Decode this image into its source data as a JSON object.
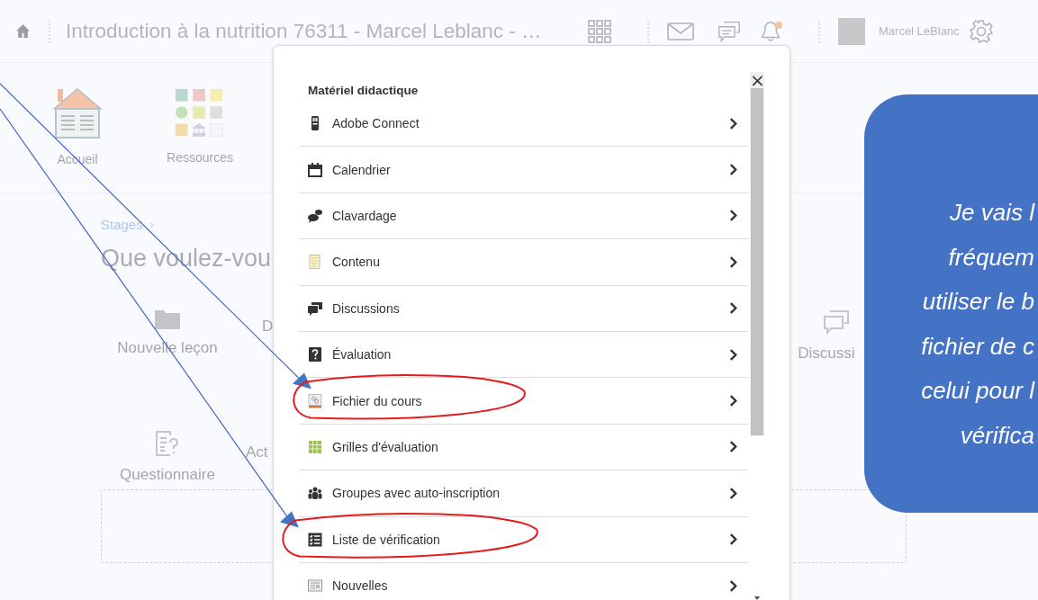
{
  "top_bar": {
    "title": "Introduction à la nutrition 76311 - Marcel Leblanc - …",
    "user_name": "Marcel LeBlanc",
    "notification_dot": true
  },
  "nav": [
    {
      "label": "Accueil",
      "kind": "home"
    },
    {
      "label": "Ressources",
      "kind": "resources"
    }
  ],
  "breadcrumb": {
    "label": "Stages",
    "separator": "›"
  },
  "heading": "Que voulez-vou",
  "tiles_row_1": [
    {
      "label": "Nouvelle leçon",
      "kind": "folder"
    },
    {
      "label": "D",
      "kind": "text"
    },
    {
      "label": "Discussi",
      "kind": "chat"
    }
  ],
  "tiles_row_2": [
    {
      "label": "Questionnaire",
      "kind": "quiz"
    },
    {
      "label": "Act",
      "kind": "text"
    }
  ],
  "modal": {
    "section_title": "Matériel didactique",
    "close": "×",
    "items": [
      {
        "label": "Adobe Connect",
        "kind": "adobe",
        "highlighted": false
      },
      {
        "label": "Calendrier",
        "kind": "calendar",
        "highlighted": false
      },
      {
        "label": "Clavardage",
        "kind": "chat",
        "highlighted": false
      },
      {
        "label": "Contenu",
        "kind": "content",
        "highlighted": false
      },
      {
        "label": "Discussions",
        "kind": "discussions",
        "highlighted": false
      },
      {
        "label": "Évaluation",
        "kind": "evaluation",
        "highlighted": false
      },
      {
        "label": "Fichier du cours",
        "kind": "file",
        "highlighted": true
      },
      {
        "label": "Grilles d'évaluation",
        "kind": "grid",
        "highlighted": false
      },
      {
        "label": "Groupes avec auto-inscription",
        "kind": "groups",
        "highlighted": false
      },
      {
        "label": "Liste de vérification",
        "kind": "checklist",
        "highlighted": true
      },
      {
        "label": "Nouvelles",
        "kind": "news",
        "highlighted": false
      }
    ]
  },
  "callout": {
    "lines": [
      "Je vais l",
      "fréquem",
      "utiliser le b",
      "fichier de c",
      "celui pour l",
      "vérifica"
    ]
  }
}
